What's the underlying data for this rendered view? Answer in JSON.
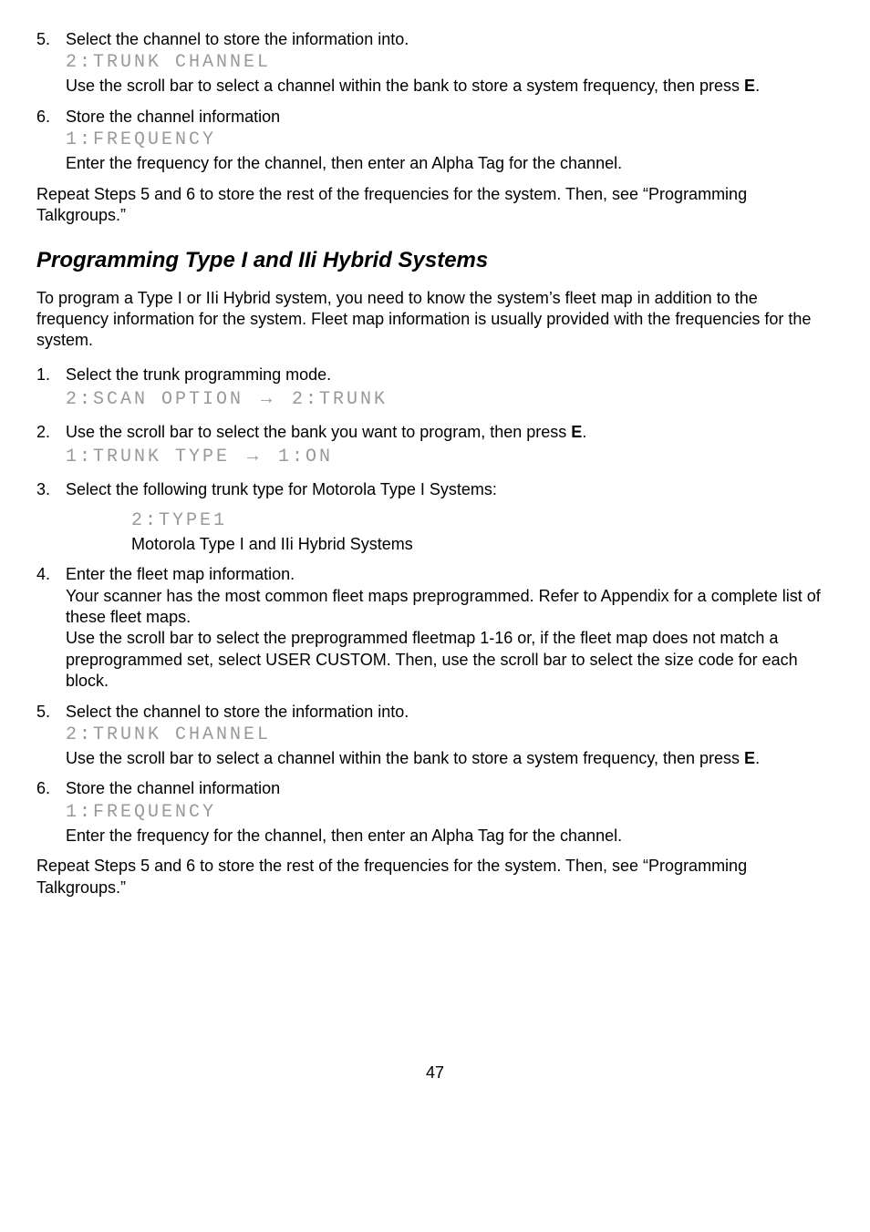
{
  "step5a": {
    "num": "5.",
    "line1": "Select the channel to store the information into.",
    "lcd": "2:TRUNK CHANNEL",
    "line2_a": "Use the scroll bar to select a channel within the bank to store a system frequency, then press ",
    "line2_bold": "E",
    "line2_b": "."
  },
  "step6a": {
    "num": "6.",
    "line1": "Store the channel information",
    "lcd": "1:FREQUENCY",
    "line2": "Enter the frequency for the channel, then enter an Alpha Tag for the channel."
  },
  "repeat_a": "Repeat Steps 5 and 6 to store the rest of the frequencies for the system. Then, see “Programming Talkgroups.”",
  "heading": "Programming Type I and IIi Hybrid Systems",
  "intro": "To program a Type I or IIi Hybrid system, you need to know the system’s fleet map in addition to the frequency information for the system. Fleet map information is usually provided with the frequencies for the system.",
  "step1": {
    "num": "1.",
    "line1": "Select the trunk programming mode.",
    "lcd_a": "2:SCAN OPTION ",
    "arrow": "→",
    "lcd_b": " 2:TRUNK"
  },
  "step2": {
    "num": "2.",
    "line1_a": "Use the scroll bar to select the bank you want to program, then press ",
    "line1_bold": "E",
    "line1_b": ".",
    "lcd_a": "1:TRUNK TYPE ",
    "arrow": "→",
    "lcd_b": " 1:ON"
  },
  "step3": {
    "num": "3.",
    "line1": "Select the following trunk type for Motorola Type I Systems:",
    "lcd": "2:TYPE1",
    "sub": "Motorola Type I and IIi Hybrid Systems"
  },
  "step4": {
    "num": "4.",
    "line1": "Enter the fleet map information.",
    "line2": "Your scanner has the most common fleet maps preprogrammed. Refer to Appendix for a complete list of these fleet maps.",
    "line3": "Use the scroll bar to select the preprogrammed fleetmap 1-16 or, if the fleet map does not match a preprogrammed set, select USER CUSTOM. Then, use the scroll bar to select the size code for each block."
  },
  "step5b": {
    "num": "5.",
    "line1": "Select the channel to store the information into.",
    "lcd": "2:TRUNK CHANNEL",
    "line2_a": "Use the scroll bar to select a channel within the bank to store a system frequency, then press ",
    "line2_bold": "E",
    "line2_b": "."
  },
  "step6b": {
    "num": "6.",
    "line1": "Store the channel information",
    "lcd": "1:FREQUENCY",
    "line2": "Enter the frequency for the channel, then enter an Alpha Tag for the channel."
  },
  "repeat_b": "Repeat Steps 5 and 6 to store the rest of the frequencies for the system. Then, see “Programming Talkgroups.”",
  "pagenum": "47"
}
